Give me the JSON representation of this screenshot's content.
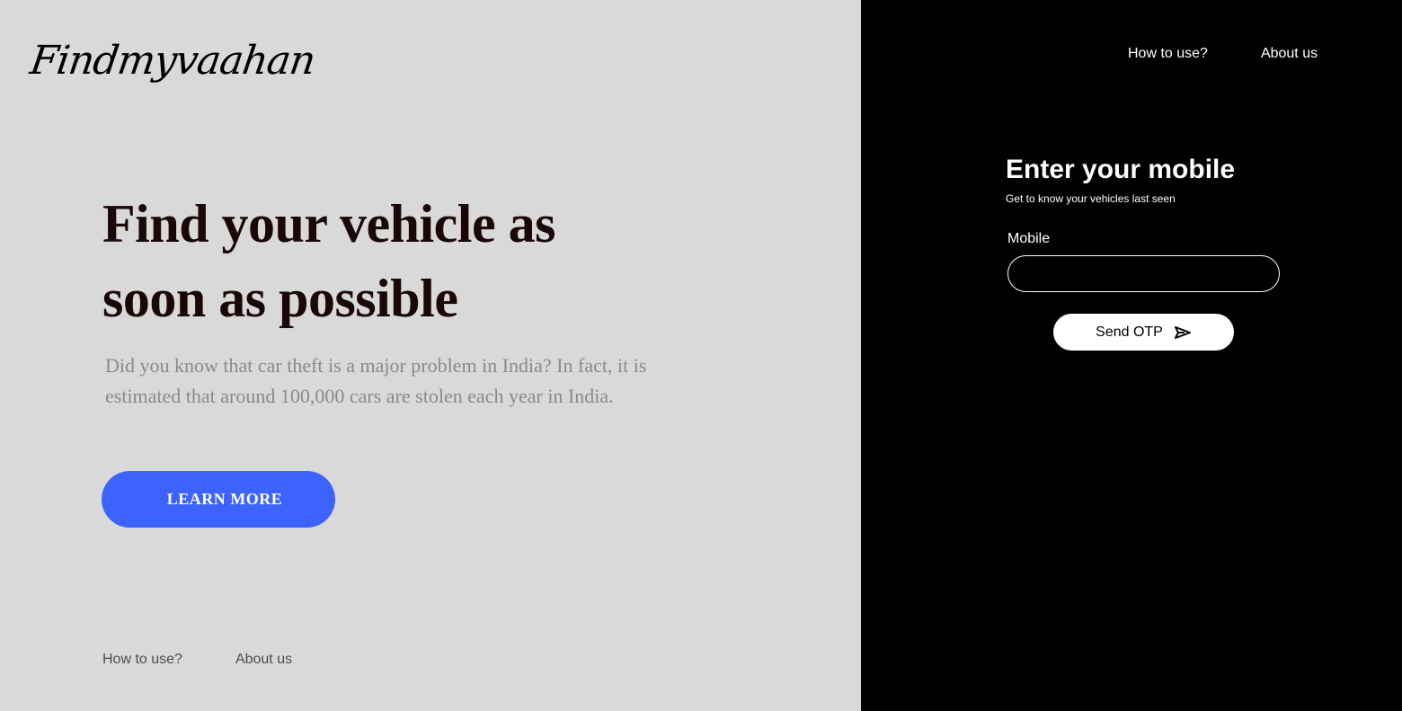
{
  "brand": {
    "logo_text": "Findmyvaahan"
  },
  "hero": {
    "headline": "Find your vehicle as soon as possible",
    "description": "Did you know that car theft is a major problem in India? In fact, it is estimated that around 100,000 cars are stolen each year in India.",
    "cta_label": "LEARN MORE"
  },
  "footer_nav": {
    "items": [
      {
        "label": "How to use?"
      },
      {
        "label": "About us"
      }
    ]
  },
  "top_nav": {
    "items": [
      {
        "label": "How to use?"
      },
      {
        "label": "About us"
      }
    ]
  },
  "login_form": {
    "title": "Enter your mobile",
    "subtitle": "Get to know your vehicles last seen",
    "mobile_label": "Mobile",
    "mobile_value": "",
    "submit_label": "Send OTP",
    "submit_icon": "send-icon"
  },
  "colors": {
    "left_bg": "#d9d9d9",
    "right_bg": "#000000",
    "accent": "#3d63ff",
    "headline": "#1a0808"
  }
}
